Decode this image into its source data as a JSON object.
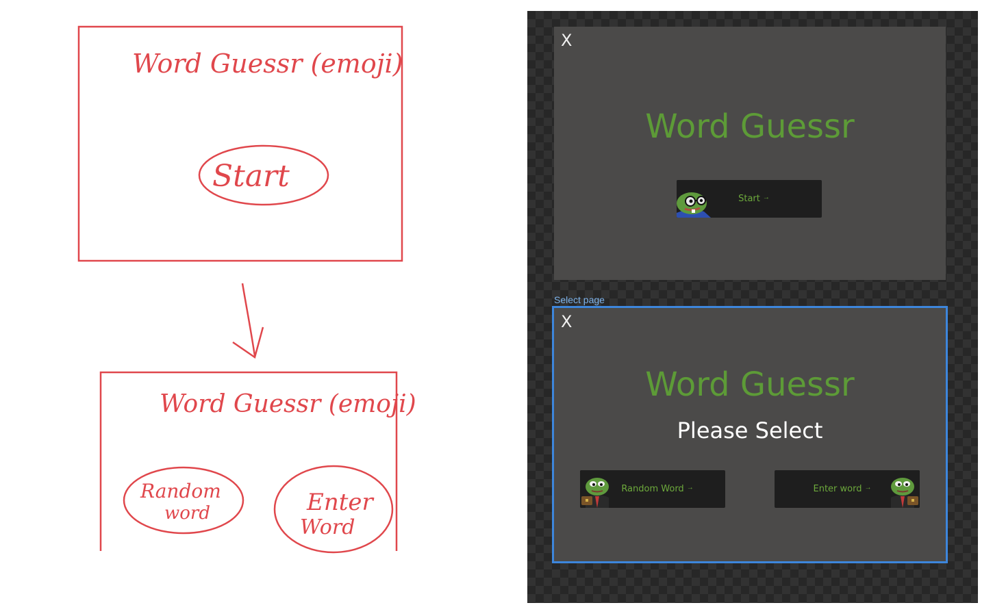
{
  "sketch": {
    "screen1_title": "Word Guessr (emoji)",
    "screen1_button": "Start",
    "screen2_title": "Word Guessr (emoji)",
    "screen2_left_button": [
      "Random",
      "word"
    ],
    "screen2_right_button": [
      "Enter",
      "Word"
    ]
  },
  "canvas": {
    "start_frame": {
      "close_label": "X",
      "title": "Word Guessr",
      "start_button": {
        "label": "Start",
        "arrow": "→"
      }
    },
    "select_frame": {
      "frame_label": "Select page",
      "close_label": "X",
      "title": "Word Guessr",
      "subtitle": "Please Select",
      "random_button": {
        "label": "Random Word",
        "arrow": "→"
      },
      "enter_button": {
        "label": "Enter word",
        "arrow": "→"
      }
    }
  },
  "colors": {
    "sketch_ink": "#e0474c",
    "title_green": "#5d9b37",
    "frame_bg": "#4b4a49",
    "selection_blue": "#3d86dc"
  },
  "icons": [
    "pepe-glasses-avatar",
    "pepe-suit-avatar",
    "close-icon",
    "arrow-right-icon"
  ]
}
